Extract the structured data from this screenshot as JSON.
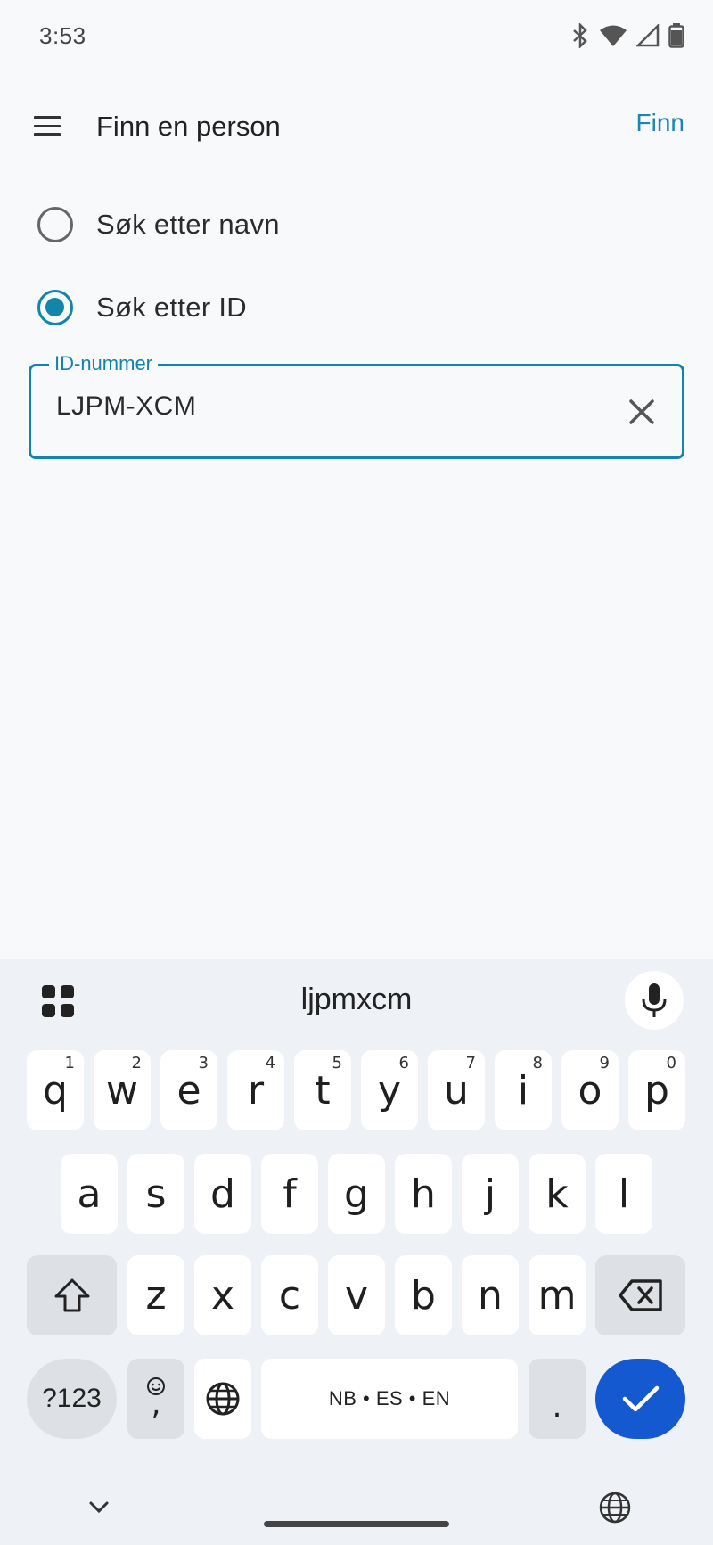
{
  "status_bar": {
    "time": "3:53",
    "icons": [
      "bluetooth-icon",
      "wifi-icon",
      "signal-icon",
      "battery-icon"
    ]
  },
  "app_bar": {
    "title": "Finn en person",
    "action_label": "Finn",
    "accent_color": "#1b86b0"
  },
  "search_options": {
    "by_name_label": "Søk etter navn",
    "by_id_label": "Søk etter ID",
    "selected": "Søk etter ID"
  },
  "id_field": {
    "label": "ID-nummer",
    "value": "LJPM-XCM"
  },
  "keyboard": {
    "suggestion": "ljpmxcm",
    "row1": [
      {
        "key": "q",
        "hint": "1"
      },
      {
        "key": "w",
        "hint": "2"
      },
      {
        "key": "e",
        "hint": "3"
      },
      {
        "key": "r",
        "hint": "4"
      },
      {
        "key": "t",
        "hint": "5"
      },
      {
        "key": "y",
        "hint": "6"
      },
      {
        "key": "u",
        "hint": "7"
      },
      {
        "key": "i",
        "hint": "8"
      },
      {
        "key": "o",
        "hint": "9"
      },
      {
        "key": "p",
        "hint": "0"
      }
    ],
    "row2": [
      "a",
      "s",
      "d",
      "f",
      "g",
      "h",
      "j",
      "k",
      "l"
    ],
    "row3": [
      "z",
      "x",
      "c",
      "v",
      "b",
      "n",
      "m"
    ],
    "symbols_label": "?123",
    "emoji_comma_label": ",",
    "space_label": "NB • ES • EN",
    "period_label": ".",
    "enter_color": "#1459d0"
  }
}
